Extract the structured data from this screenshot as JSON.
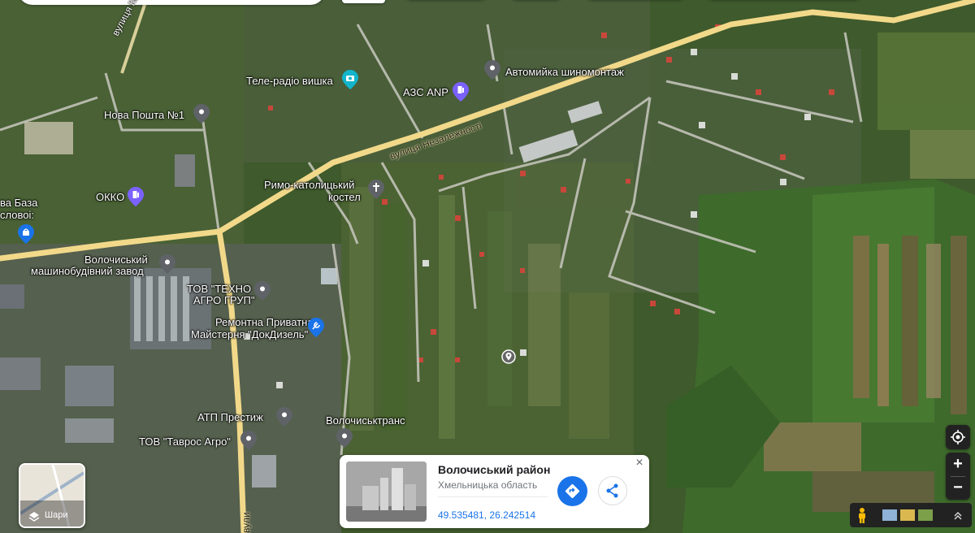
{
  "map": {
    "labels": {
      "tower": "Теле-радіо вишка",
      "carwash": "Автомийка шиномонтаж",
      "gas_anp": "АЗС ANP",
      "nova_poshta": "Нова Пошта №1",
      "okko": "ОККО",
      "baza_1": "ва База",
      "baza_2": "словоі:",
      "church_1": "Римо-католицький",
      "church_2": "костел",
      "plant_1": "Волочиський",
      "plant_2": "машинобудівний завод",
      "techno_1": "ТОВ \"ТЕХНО",
      "techno_2": "АГРО ГРУП\"",
      "repair_1": "Ремонтна Приватна",
      "repair_2": "Майстерня \"ДокДизель\"",
      "atp": "АТП Престиж",
      "trans": "Волочиськтранс",
      "tavros": "ТОВ \"Таврос Агро\"",
      "street_kolachivska": "вулиця Колачівськ",
      "street_nezalezhnosti": "вулиця Незалежності",
      "street_bottom": "вули"
    }
  },
  "place_card": {
    "title": "Волочиський район",
    "subtitle": "Хмельницька область",
    "coords": "49.535481, 26.242514",
    "close": "×"
  },
  "layers": {
    "label": "Шари"
  },
  "controls": {
    "zoom_in": "+",
    "zoom_out": "−"
  },
  "colors": {
    "accent": "#1a73e8",
    "road": "#f2d98a",
    "pin": "#5f6368",
    "pin_purple": "#7b61ff",
    "pin_teal": "#12b5cb"
  }
}
